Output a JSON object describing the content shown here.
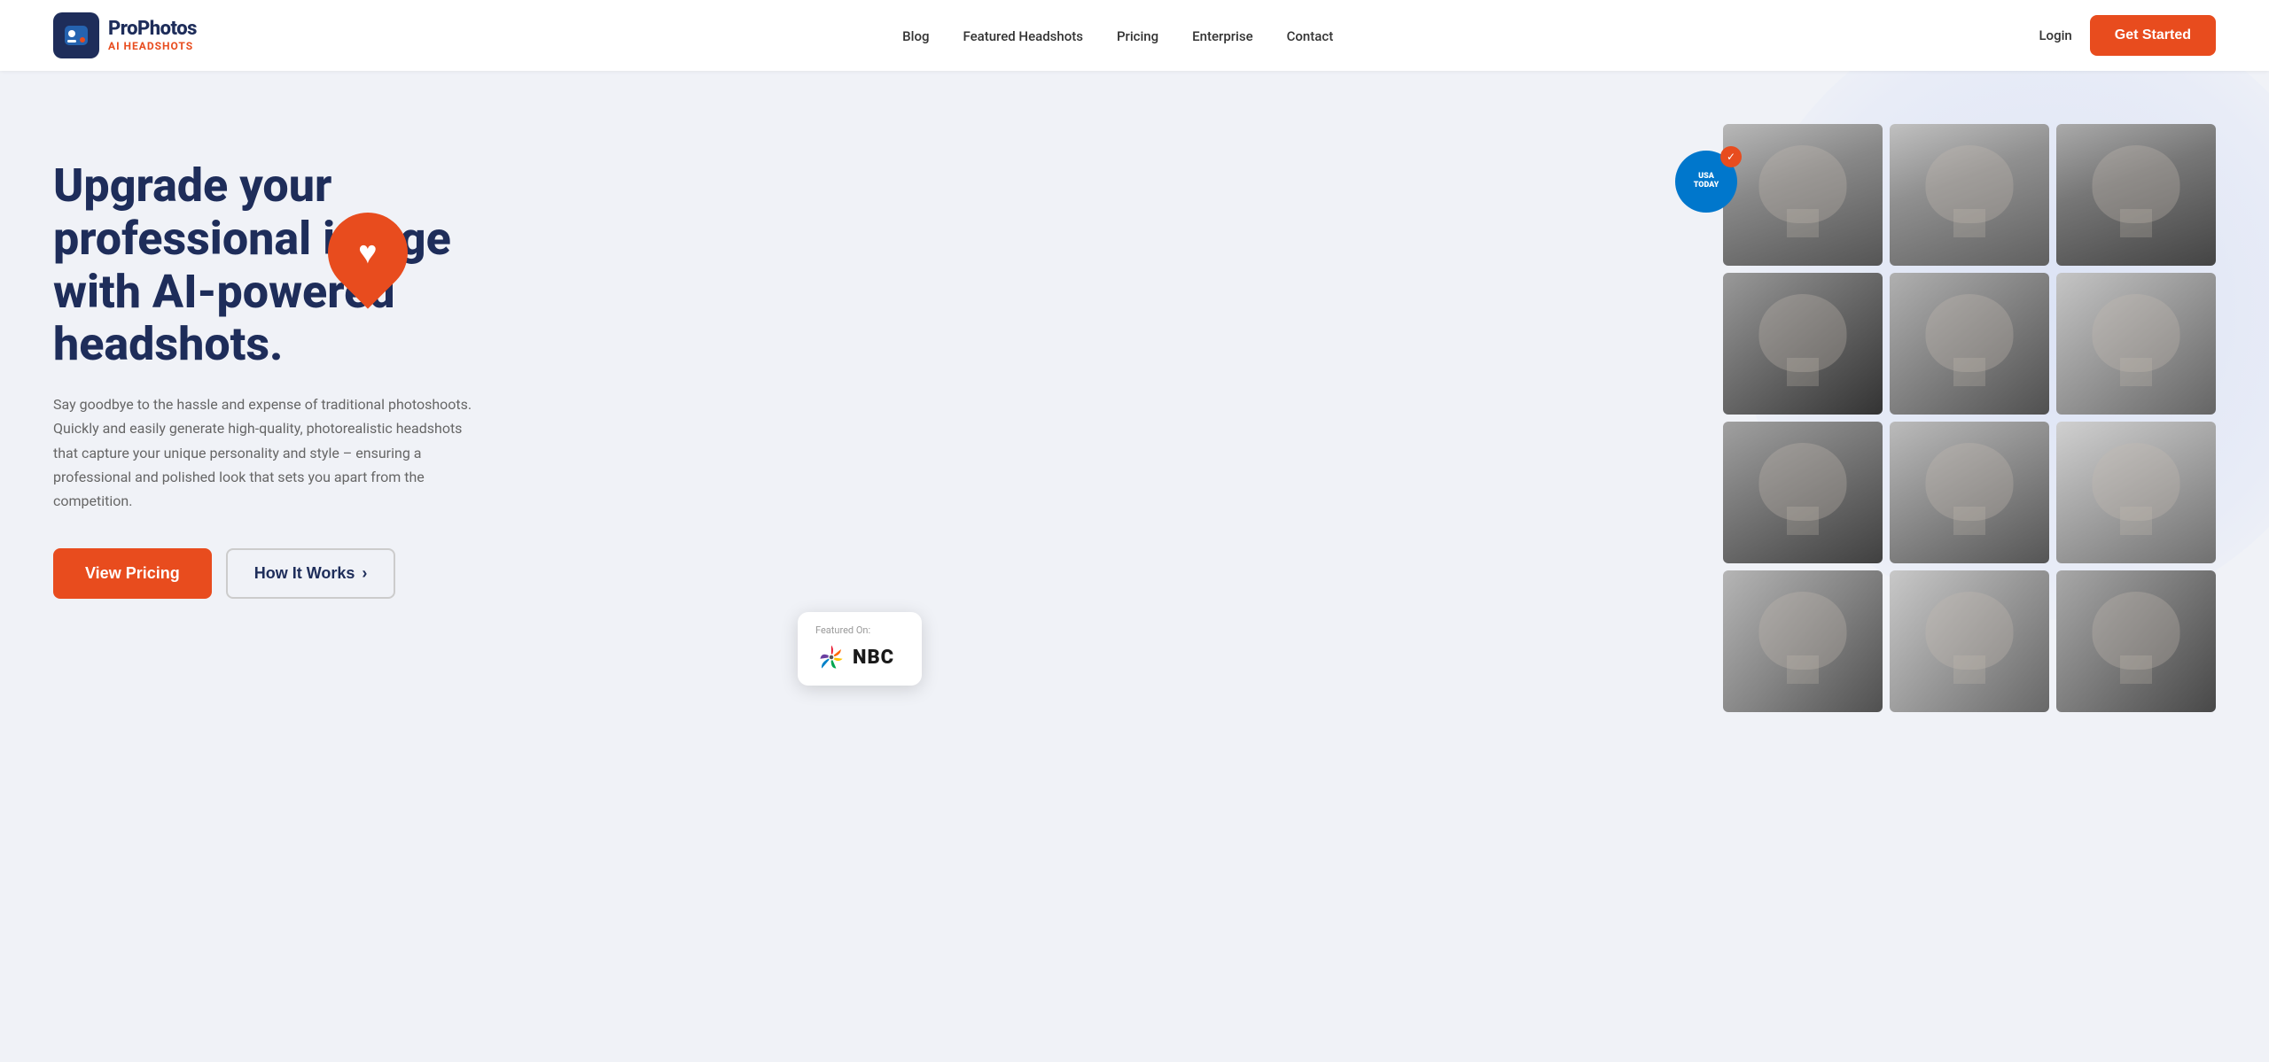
{
  "brand": {
    "name": "ProPhotos",
    "ai_label": "AI HEADSHOTS",
    "logo_bg": "#1e2d5a"
  },
  "nav": {
    "links": [
      {
        "label": "Blog",
        "href": "#"
      },
      {
        "label": "Featured Headshots",
        "href": "#"
      },
      {
        "label": "Pricing",
        "href": "#"
      },
      {
        "label": "Enterprise",
        "href": "#"
      },
      {
        "label": "Contact",
        "href": "#"
      }
    ],
    "login_label": "Login",
    "cta_label": "Get Started"
  },
  "hero": {
    "title": "Upgrade your professional image with AI-powered headshots.",
    "subtitle": "Say goodbye to the hassle and expense of traditional photoshoots. Quickly and easily generate high-quality, photorealistic headshots that capture your unique personality and style – ensuring a professional and polished look that sets you apart from the competition.",
    "btn_pricing": "View Pricing",
    "btn_how": "How It Works",
    "btn_how_arrow": "›"
  },
  "badges": {
    "usa_today_line1": "USA",
    "usa_today_line2": "TODAY",
    "featured_on_label": "Featured On:",
    "nbc_text": "NBC"
  },
  "photos": [
    {
      "id": 1,
      "class": "p1"
    },
    {
      "id": 2,
      "class": "p2"
    },
    {
      "id": 3,
      "class": "p3"
    },
    {
      "id": 4,
      "class": "p4"
    },
    {
      "id": 5,
      "class": "p5"
    },
    {
      "id": 6,
      "class": "p6"
    },
    {
      "id": 7,
      "class": "p7"
    },
    {
      "id": 8,
      "class": "p8"
    },
    {
      "id": 9,
      "class": "p9"
    },
    {
      "id": 10,
      "class": "p10"
    },
    {
      "id": 11,
      "class": "p11"
    },
    {
      "id": 12,
      "class": "p12"
    }
  ]
}
